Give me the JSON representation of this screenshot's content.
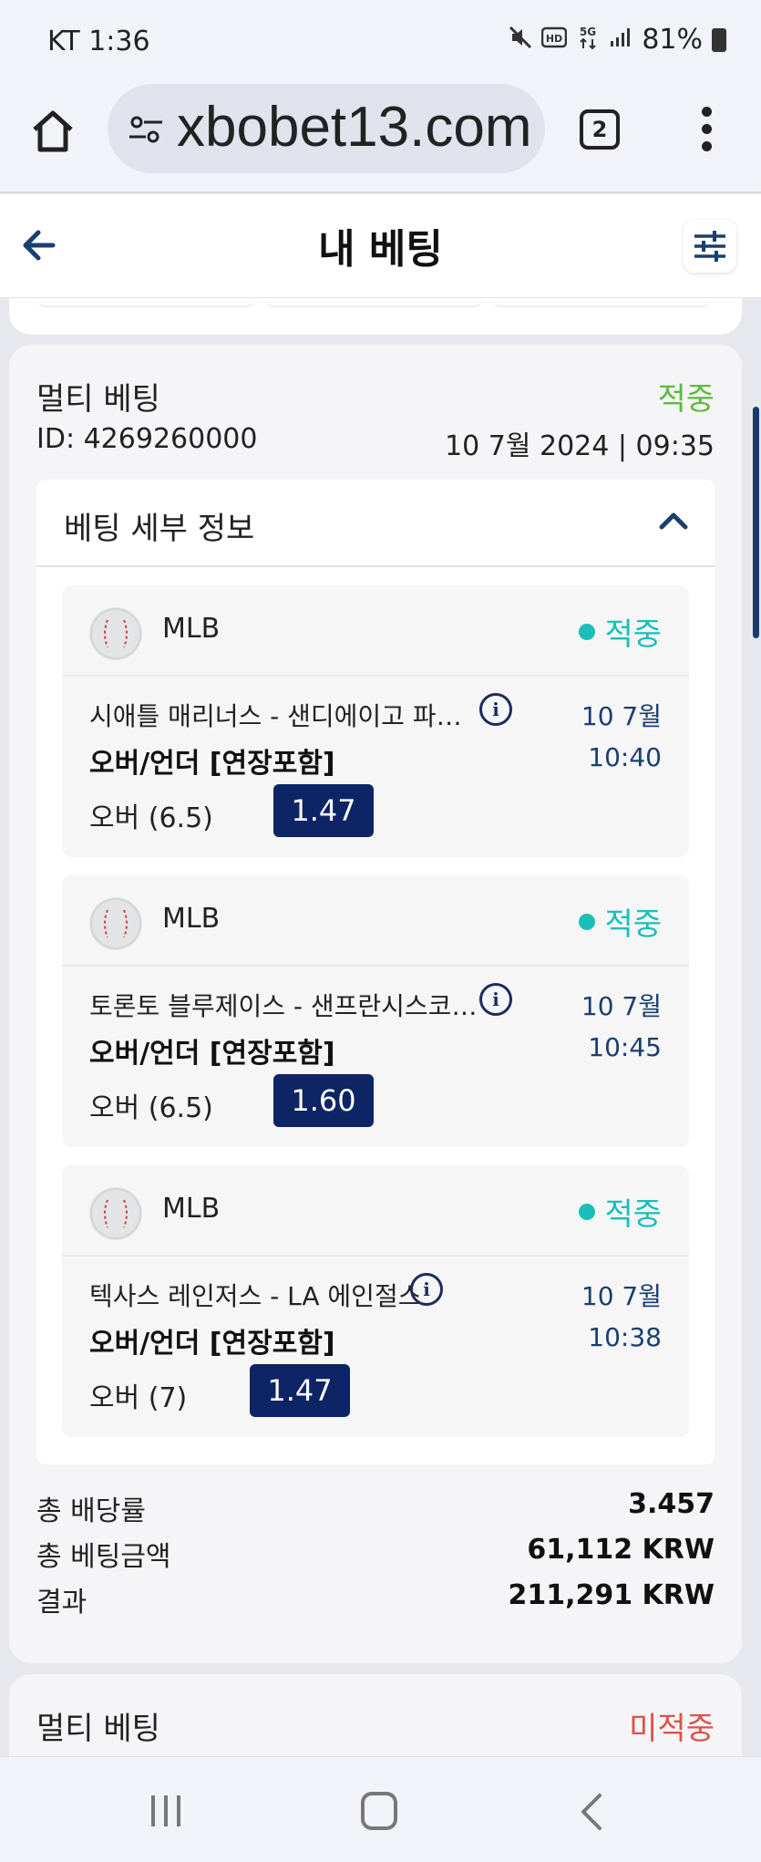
{
  "status_bar": {
    "carrier_time": "KT 1:36",
    "battery": "81%",
    "icons": [
      "mute-icon",
      "hd-icon",
      "5g-icon",
      "signal-icon",
      "battery-icon"
    ]
  },
  "browser": {
    "url": "xbobet13.com",
    "tab_count": "2"
  },
  "header": {
    "title": "내 베팅"
  },
  "bet": {
    "type": "멀티 베팅",
    "status": "적중",
    "id": "ID: 4269260000",
    "datetime": "10 7월 2024 | 09:35",
    "details_title": "베팅 세부 정보",
    "selections": [
      {
        "league": "MLB",
        "status": "적중",
        "match": "시애틀 매리너스 - 샌디에이고 파…",
        "date": "10 7월",
        "time": "10:40",
        "market": "오버/언더 [연장포함]",
        "pick": "오버 (6.5)",
        "odds": "1.47"
      },
      {
        "league": "MLB",
        "status": "적중",
        "match": "토론토 블루제이스 - 샌프란시스코…",
        "date": "10 7월",
        "time": "10:45",
        "market": "오버/언더 [연장포함]",
        "pick": "오버 (6.5)",
        "odds": "1.60"
      },
      {
        "league": "MLB",
        "status": "적중",
        "match": "텍사스 레인저스 - LA 에인절스",
        "date": "10 7월",
        "time": "10:38",
        "market": "오버/언더 [연장포함]",
        "pick": "오버 (7)",
        "odds": "1.47"
      }
    ],
    "summary": {
      "total_odds_label": "총 배당률",
      "total_odds": "3.457",
      "total_stake_label": "총 베팅금액",
      "total_stake": "61,112 KRW",
      "result_label": "결과",
      "result": "211,291 KRW"
    }
  },
  "next_bet": {
    "type": "멀티 베팅",
    "status": "미적중"
  },
  "colors": {
    "won": "#5cbb3c",
    "selection_won": "#1bbfba",
    "lost": "#e0504a",
    "odds_bg": "#0e2565"
  }
}
